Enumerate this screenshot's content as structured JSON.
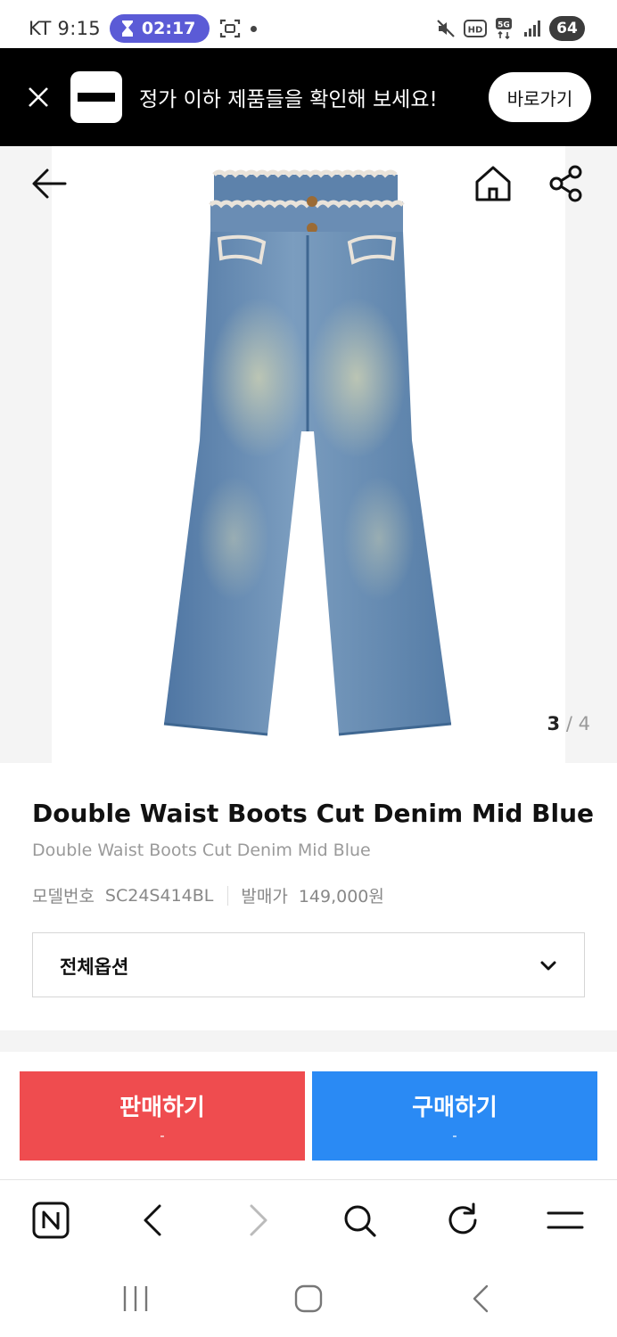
{
  "status_bar": {
    "carrier_time": "KT 9:15",
    "timer": "02:17",
    "battery": "64",
    "network": "5G",
    "hd": "HD"
  },
  "promo": {
    "text": "정가 이하 제품들을 확인해 보세요!",
    "cta": "바로가기"
  },
  "gallery": {
    "current": "3",
    "separator": "/",
    "total": "4"
  },
  "product": {
    "title": "Double Waist Boots Cut Denim Mid Blue",
    "subtitle": "Double Waist Boots Cut Denim Mid Blue",
    "model_label": "모델번호",
    "model_number": "SC24S414BL",
    "price_label": "발매가",
    "price": "149,000원"
  },
  "options": {
    "selected": "전체옵션"
  },
  "actions": {
    "sell_label": "판매하기",
    "sell_price": "-",
    "buy_label": "구매하기",
    "buy_price": "-"
  },
  "colors": {
    "sell": "#ef4c4f",
    "buy": "#2a8af4",
    "timer": "#5b5bd6",
    "banner": "#000000"
  },
  "icons": {
    "back": "arrow-left-icon",
    "home": "home-icon",
    "share": "share-icon",
    "chevron": "chevron-down-icon"
  }
}
